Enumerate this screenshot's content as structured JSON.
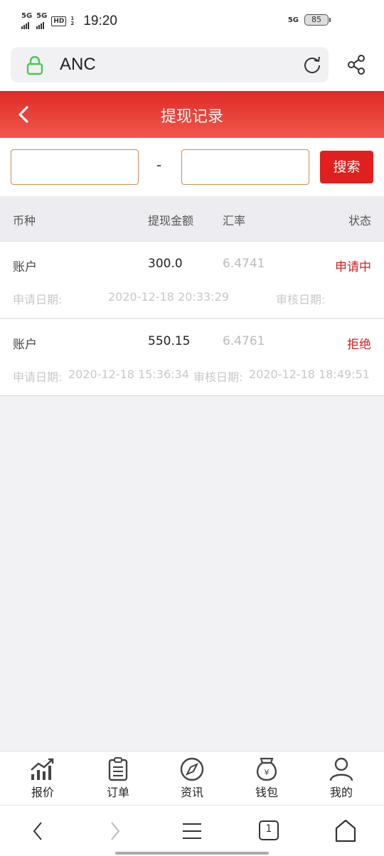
{
  "status_bar": {
    "signal_1": "5G",
    "signal_2": "5G",
    "hd": "HD",
    "hd_sub": "1 2",
    "time": "19:20",
    "net": "5G",
    "battery": "85"
  },
  "browser": {
    "url": "ANC"
  },
  "header": {
    "title": "提现记录"
  },
  "search": {
    "from_value": "",
    "to_value": "",
    "separator": "-",
    "button_label": "搜索"
  },
  "table": {
    "headers": {
      "currency": "币种",
      "amount": "提现金额",
      "rate": "汇率",
      "status": "状态"
    },
    "rows": [
      {
        "currency": "账户",
        "amount": "300.0",
        "rate": "6.4741",
        "status": "申请中",
        "apply_label": "申请日期:",
        "apply_date": "2020-12-18 20:33:29",
        "review_label": "审核日期:",
        "review_date": ""
      },
      {
        "currency": "账户",
        "amount": "550.15",
        "rate": "6.4761",
        "status": "拒绝",
        "apply_label": "申请日期:",
        "apply_date": "2020-12-18 15:36:34",
        "review_label": "审核日期:",
        "review_date": "2020-12-18 18:49:51"
      }
    ]
  },
  "tabbar": {
    "items": [
      {
        "label": "报价",
        "icon": "chart-icon"
      },
      {
        "label": "订单",
        "icon": "clipboard-icon"
      },
      {
        "label": "资讯",
        "icon": "compass-icon"
      },
      {
        "label": "钱包",
        "icon": "money-bag-icon"
      },
      {
        "label": "我的",
        "icon": "user-icon"
      }
    ]
  },
  "browser_nav": {
    "tab_count": "1"
  },
  "colors": {
    "accent": "#e01f1f",
    "header_top": "#e02a26",
    "header_bottom": "#f0584a",
    "status_red": "#d22020",
    "lock_green": "#4cc552"
  }
}
